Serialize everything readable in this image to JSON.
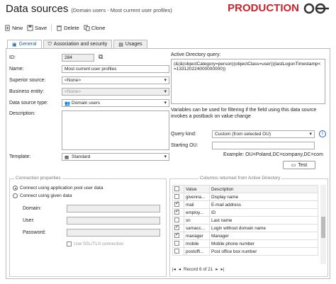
{
  "header": {
    "title": "Data sources",
    "subtitle": "(Domain users - Most current user profiles)",
    "brand": "PRODUCTION"
  },
  "toolbar": {
    "new": "New",
    "save": "Save",
    "delete": "Delete",
    "clone": "Clone"
  },
  "tabs": [
    {
      "label": "General"
    },
    {
      "label": "Association and security"
    },
    {
      "label": "Usages"
    }
  ],
  "form": {
    "id_label": "ID:",
    "id_value": "284",
    "name_label": "Name:",
    "name_value": "Most current user profiles",
    "superior_label": "Superior source:",
    "superior_value": "<None>",
    "entity_label": "Business entity:",
    "entity_value": "<None>",
    "type_label": "Data source type:",
    "type_value": "Domain users",
    "description_label": "Description:",
    "template_label": "Template:",
    "template_value": "Standard"
  },
  "ad": {
    "query_label": "Active Directory query:",
    "query_value": "(&(&(objectCategory=person)(objectClass=user))(lastLogonTimestamp<=133120224000000000))",
    "note": "Variables can be used for filtering if the field using this data source invokes a postback on value change",
    "kind_label": "Query kind:",
    "kind_value": "Custom (from selected OU)",
    "ou_label": "Starting OU:",
    "example": "Example: OU=Poland,DC=company,DC=com",
    "test_label": "Test"
  },
  "connection": {
    "title": "Connection properties",
    "opt1": "Connect using application pool user data",
    "opt2": "Connect using given data",
    "domain_label": "Domain:",
    "user_label": "User:",
    "password_label": "Password:",
    "ssl_label": "Use SSL/TLS connection"
  },
  "columns": {
    "title": "Columns returned from Active Directory",
    "headers": [
      "Value",
      "Description"
    ],
    "rows": [
      {
        "value": "givenna...",
        "desc": "Display name",
        "checked": false
      },
      {
        "value": "mail",
        "desc": "E-mail address",
        "checked": true
      },
      {
        "value": "employ...",
        "desc": "ID",
        "checked": true
      },
      {
        "value": "sn",
        "desc": "Last name",
        "checked": false
      },
      {
        "value": "samacc...",
        "desc": "Login without domain name",
        "checked": true
      },
      {
        "value": "manager",
        "desc": "Manager",
        "checked": true
      },
      {
        "value": "mobile",
        "desc": "Mobile phone number",
        "checked": false
      },
      {
        "value": "postoffi...",
        "desc": "Post office box number",
        "checked": false
      }
    ],
    "pager": "Record 6 of 21"
  }
}
